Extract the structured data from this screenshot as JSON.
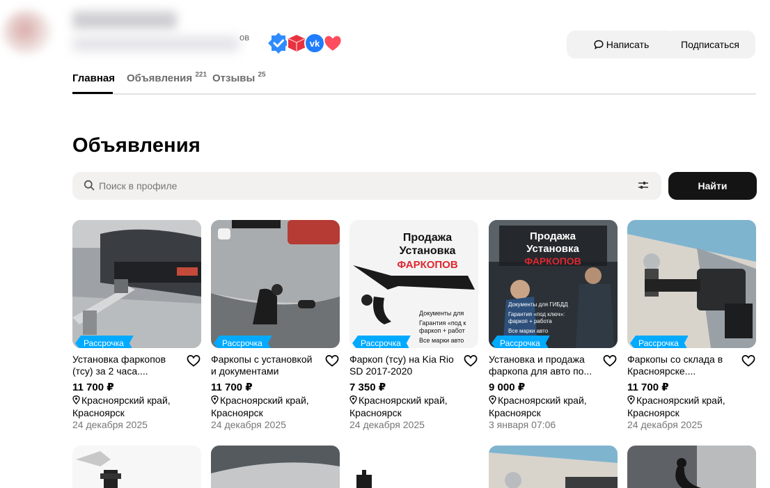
{
  "profile": {
    "subtitle_suffix": "ов",
    "badges": [
      "verified-badge-icon",
      "cube-badge-icon",
      "vk-badge-icon",
      "heart-badge-icon"
    ],
    "write_label": "Написать",
    "subscribe_label": "Подписаться"
  },
  "tabs": [
    {
      "label": "Главная",
      "count": ""
    },
    {
      "label": "Объявления",
      "count": "221"
    },
    {
      "label": "Отзывы",
      "count": "25"
    }
  ],
  "section_title": "Объявления",
  "search": {
    "placeholder": "Поиск в профиле",
    "value": "",
    "button_label": "Найти"
  },
  "listings": [
    {
      "badge": "Рассрочка",
      "title": "Установка фаркопов (тсу) за 2 часа....",
      "price": "11 700 ₽",
      "location": "Красноярский край, Красноярск",
      "date": "24 декабря 2025"
    },
    {
      "badge": "Рассрочка",
      "title": "Фаркопы с установкой и документами",
      "price": "11 700 ₽",
      "location": "Красноярский край, Красноярск",
      "date": "24 декабря 2025"
    },
    {
      "badge": "Рассрочка",
      "title": "Фаркоп (тсу) на Kia Rio SD 2017-2020",
      "price": "7 350 ₽",
      "location": "Красноярский край, Красноярск",
      "date": "24 декабря 2025",
      "img_text": [
        "Продажа",
        "Установка",
        "ФАРКОПОВ",
        "Документы для",
        "Гарантия «под к",
        "фаркоп + работ",
        "Все марки авто"
      ]
    },
    {
      "badge": "Рассрочка",
      "title": "Установка и продажа фаркопа для авто по...",
      "price": "9 000 ₽",
      "location": "Красноярский край, Красноярск",
      "date": "3 января 07:06",
      "img_text": [
        "Продажа",
        "Установка",
        "ФАРКОПОВ",
        "Документы для ГИБДД",
        "Гарантия «под ключ»:",
        "фаркоп + работа",
        "Все марки авто"
      ]
    },
    {
      "badge": "Рассрочка",
      "title": "Фаркопы со склада в Красноярске....",
      "price": "11 700 ₽",
      "location": "Красноярский край, Красноярск",
      "date": "24 декабря 2025"
    }
  ],
  "colors": {
    "accent_blue": "#00aaff",
    "dark_button": "#141414",
    "muted_text": "#767676",
    "light_bg": "#f2f2f2"
  }
}
